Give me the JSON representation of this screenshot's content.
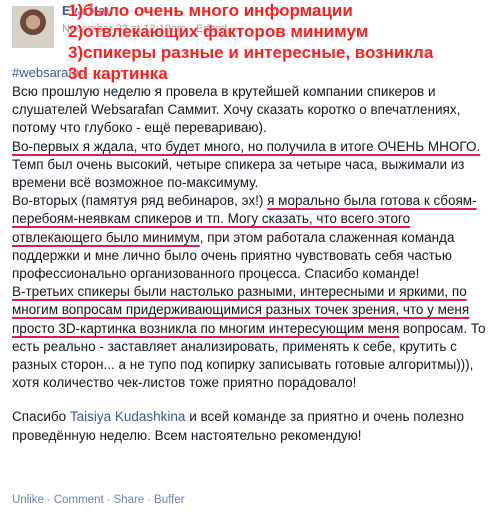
{
  "post": {
    "author": "Eva Nau",
    "meta": "November 23 at 12:19am · Edited ·",
    "hashtag": "#websarafan",
    "annotations": [
      "1)было очень много информации",
      "2)отвлекающих факторов минимум",
      "3)спикеры разные и интересные, возникла",
      "3d картинка"
    ],
    "paragraph1": "Всю прошлую неделю я провела в крутейшей компании спикеров и слушателей Websarafan Саммит. Хочу сказать коротко о впечатлениях, потому что глубоко - ещё перевариваю).",
    "p2_u": "Во-первых я ждала, что будет много, но получила в итоге ОЧЕНЬ МНОГО.",
    "p2_rest": " Темп был очень высокий, четыре спикера за четыре часа, выжимали из времени всё возможное по-максимуму.",
    "p3_start": "Во-вторых (памятуя ряд вебинаров, эх!) ",
    "p3_u": "я морально была готова к сбоям-перебоям-неявкам спикеров и тп. Могу сказать, что всего этого отвлекающего было минимум",
    "p3_rest": ", при этом работала слаженная команда поддержки и мне лично было очень приятно чувствовать себя частью профессионально организованного процесса. Спасибо команде!",
    "p4_u": "В-третьих спикеры были настолько разными, интересными и яркими, по многим вопросам придерживающимися разных точек зрения, что у меня просто 3D-картинка возникла по многим интересующим меня",
    "p4_rest": " вопросам. То есть реально - заставляет анализировать, применять к себе, крутить с разных сторон... а не тупо под копирку записывать готовые алгоритмы))), хотя количество чек-листов тоже приятно порадовало!",
    "p5_start": "Спасибо ",
    "p5_link": "Taisiya Kudashkina",
    "p5_rest": " и всей команде за приятно и очень полезно проведённую неделю. Всем настоятельно рекомендую!"
  },
  "actions": {
    "unlike": "Unlike",
    "comment": "Comment",
    "share": "Share",
    "buffer": "Buffer",
    "separator": "·"
  },
  "colors": {
    "link": "#3b5998",
    "annotation": "#ff1e1e",
    "underline": "#e0195a"
  }
}
